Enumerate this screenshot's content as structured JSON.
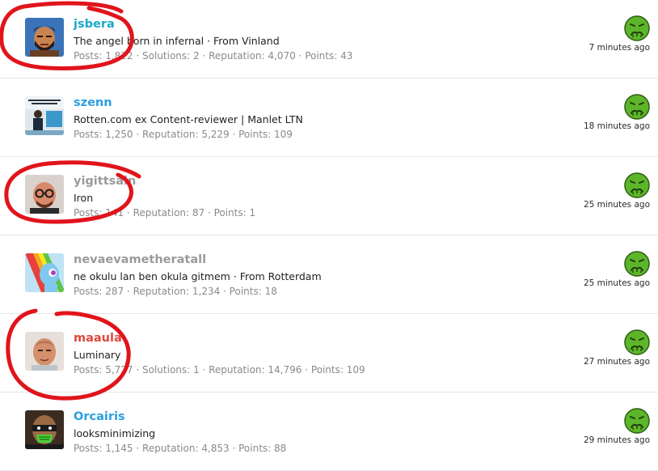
{
  "members": [
    {
      "username": "jsbera",
      "name_color": "#1ba8c8",
      "title": "The angel born in infernal · From Vinland",
      "stats": "Posts: 1,822 · Solutions: 2 · Reputation: 4,070 · Points: 43",
      "reaction_icon": "sick-face-icon",
      "time": "7 minutes ago",
      "avatar": "avatar-cartoon-beard",
      "circled": true
    },
    {
      "username": "szenn",
      "name_color": "#2a9fe0",
      "title": "Rotten.com ex Content-reviewer | Manlet LTN",
      "stats": "Posts: 1,250 · Reputation: 5,229 · Points: 109",
      "reaction_icon": "sick-face-icon",
      "time": "18 minutes ago",
      "avatar": "avatar-photo-presenter",
      "circled": false
    },
    {
      "username": "yigittsain",
      "name_color": "#9a9a9a",
      "title": "Iron",
      "stats": "Posts: 141 · Reputation: 87 · Points: 1",
      "reaction_icon": "sick-face-icon",
      "time": "25 minutes ago",
      "avatar": "avatar-cartoon-glasses",
      "circled": true
    },
    {
      "username": "nevaevametheratall",
      "name_color": "#9a9a9a",
      "title": "ne okulu lan ben okula gitmem · From Rotterdam",
      "stats": "Posts: 287 · Reputation: 1,234 · Points: 18",
      "reaction_icon": "sick-face-icon",
      "time": "25 minutes ago",
      "avatar": "avatar-rainbow-pony",
      "circled": false
    },
    {
      "username": "maaula",
      "name_color": "#e0483a",
      "title": "Luminary",
      "stats": "Posts: 5,727 · Solutions: 1 · Reputation: 14,796 · Points: 109",
      "reaction_icon": "sick-face-icon",
      "time": "27 minutes ago",
      "avatar": "avatar-cartoon-bald",
      "circled": true
    },
    {
      "username": "Orcairis",
      "name_color": "#2a9fe0",
      "title": "looksminimizing",
      "stats": "Posts: 1,145 · Reputation: 4,853 · Points: 88",
      "reaction_icon": "sick-face-icon",
      "time": "29 minutes ago",
      "avatar": "avatar-cartoon-green-mask",
      "circled": false
    }
  ],
  "colors": {
    "annotation_red": "#e1141b",
    "reaction_green": "#5db52a",
    "divider": "#e6e6e6"
  }
}
